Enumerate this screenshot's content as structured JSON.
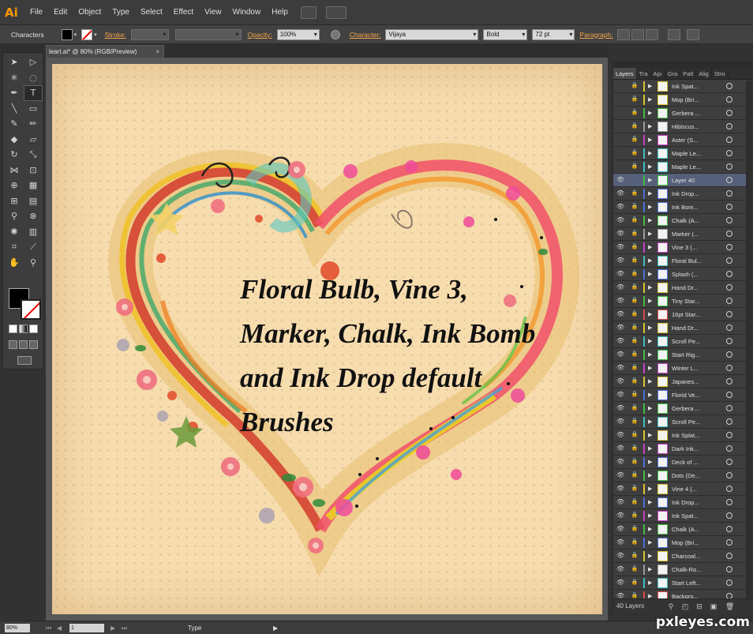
{
  "menubar": {
    "logo": "Ai",
    "items": [
      "File",
      "Edit",
      "Object",
      "Type",
      "Select",
      "Effect",
      "View",
      "Window",
      "Help"
    ]
  },
  "control": {
    "mode_label": "Characters",
    "stroke_label": "Stroke:",
    "opacity_label": "Opacity:",
    "opacity_value": "100%",
    "character_label": "Character:",
    "font_family": "Vijaya",
    "font_style": "Bold",
    "font_size": "72 pt",
    "paragraph_label": "Paragraph:"
  },
  "document": {
    "tab_title": "leart.ai* @ 80% (RGB/Preview)",
    "close_glyph": "×"
  },
  "canvas": {
    "caption_lines": [
      "Floral Bulb, Vine 3,",
      "Marker, Chalk, Ink Bomb",
      "and Ink Drop default",
      "Brushes"
    ]
  },
  "panel": {
    "tabs": [
      "Layers",
      "Tra",
      "Apı",
      "Gra",
      "Patl",
      "Alig",
      "Stro"
    ],
    "layers": [
      {
        "name": "Ink Spat...",
        "color": "#d9c430",
        "visible": false,
        "locked": true
      },
      {
        "name": "Mop (Bri...",
        "color": "#d9c430",
        "visible": false,
        "locked": true
      },
      {
        "name": "Gerbera ...",
        "color": "#3fbf3f",
        "visible": false,
        "locked": true
      },
      {
        "name": "Hibiscus...",
        "color": "#9a9a9a",
        "visible": false,
        "locked": true
      },
      {
        "name": "Aster (S...",
        "color": "#c43fc4",
        "visible": false,
        "locked": true
      },
      {
        "name": "Maple Le...",
        "color": "#3fbfbf",
        "visible": false,
        "locked": true
      },
      {
        "name": "Maple Le...",
        "color": "#3fbfbf",
        "visible": false,
        "locked": true
      },
      {
        "name": "Layer 40",
        "color": "#3fbf3f",
        "visible": true,
        "locked": false,
        "selected": true
      },
      {
        "name": "Ink Drop...",
        "color": "#4a6fd9",
        "visible": true,
        "locked": true
      },
      {
        "name": "Ink Bom...",
        "color": "#4a6fd9",
        "visible": true,
        "locked": true
      },
      {
        "name": "Chalk (A...",
        "color": "#3fbf3f",
        "visible": true,
        "locked": true
      },
      {
        "name": "Marker (...",
        "color": "#9a9a9a",
        "visible": true,
        "locked": true
      },
      {
        "name": "Vine 3 (...",
        "color": "#c43fc4",
        "visible": true,
        "locked": true
      },
      {
        "name": "Floral Bul...",
        "color": "#3fbfbf",
        "visible": true,
        "locked": true
      },
      {
        "name": "Splash (...",
        "color": "#4a6fd9",
        "visible": true,
        "locked": true
      },
      {
        "name": "Hand Dr...",
        "color": "#d9c430",
        "visible": true,
        "locked": true
      },
      {
        "name": "Tiny Star...",
        "color": "#3fbf3f",
        "visible": true,
        "locked": true
      },
      {
        "name": "16pt Star...",
        "color": "#d94a4a",
        "visible": true,
        "locked": true
      },
      {
        "name": "Hand Dr...",
        "color": "#d9c430",
        "visible": true,
        "locked": true
      },
      {
        "name": "Scroll Pe...",
        "color": "#3fbfbf",
        "visible": true,
        "locked": true
      },
      {
        "name": "Start Rig...",
        "color": "#3fbf3f",
        "visible": true,
        "locked": true
      },
      {
        "name": "Winter L...",
        "color": "#c43fc4",
        "visible": true,
        "locked": true
      },
      {
        "name": "Japanes...",
        "color": "#d9c430",
        "visible": true,
        "locked": true
      },
      {
        "name": "Florid Ve...",
        "color": "#4a6fd9",
        "visible": true,
        "locked": true
      },
      {
        "name": "Gerbera ...",
        "color": "#3fbf3f",
        "visible": true,
        "locked": true
      },
      {
        "name": "Scroll Pe...",
        "color": "#3fbfbf",
        "visible": true,
        "locked": true
      },
      {
        "name": "Ink Splat...",
        "color": "#d9c430",
        "visible": true,
        "locked": true
      },
      {
        "name": "Dark Ink...",
        "color": "#c43fc4",
        "visible": true,
        "locked": true
      },
      {
        "name": "Deck of ...",
        "color": "#4a6fd9",
        "visible": true,
        "locked": true
      },
      {
        "name": "Dots (De...",
        "color": "#3fbf3f",
        "visible": true,
        "locked": true
      },
      {
        "name": "Vine 4 (...",
        "color": "#d9c430",
        "visible": true,
        "locked": true
      },
      {
        "name": "Ink Drop...",
        "color": "#4a6fd9",
        "visible": true,
        "locked": true
      },
      {
        "name": "Ink Spat...",
        "color": "#c43fc4",
        "visible": true,
        "locked": true
      },
      {
        "name": "Chalk (A...",
        "color": "#3fbf3f",
        "visible": true,
        "locked": true
      },
      {
        "name": "Mop (Bri...",
        "color": "#4a6fd9",
        "visible": true,
        "locked": true
      },
      {
        "name": "Charcoal...",
        "color": "#d9c430",
        "visible": true,
        "locked": true
      },
      {
        "name": "Chalk-Ro...",
        "color": "#9a9a9a",
        "visible": true,
        "locked": true
      },
      {
        "name": "Start Left...",
        "color": "#3fbfbf",
        "visible": true,
        "locked": true
      },
      {
        "name": "Backgro...",
        "color": "#d94a4a",
        "visible": true,
        "locked": true
      }
    ],
    "footer_count": "40 Layers"
  },
  "status": {
    "zoom": "80%",
    "page": "1",
    "tool_name": "Type"
  },
  "watermark": "pxleyes.com"
}
